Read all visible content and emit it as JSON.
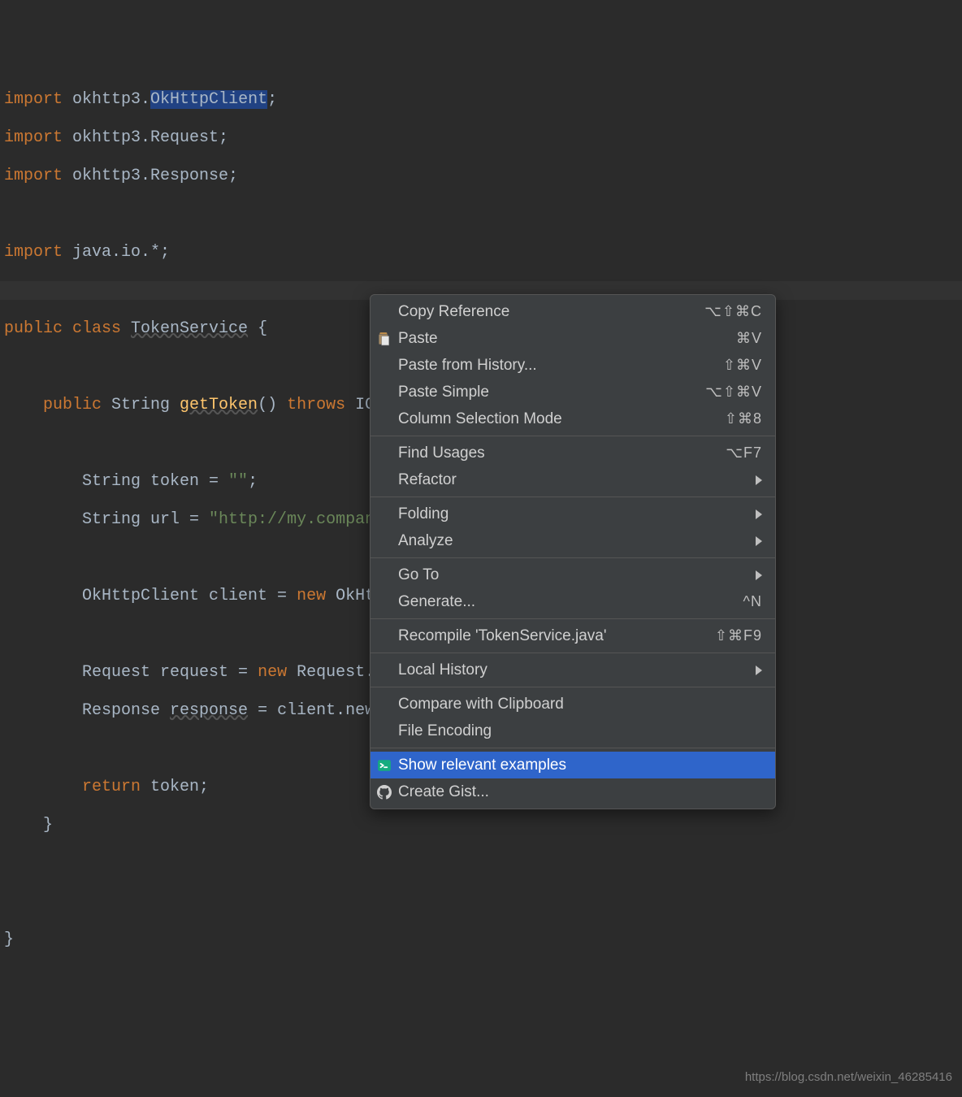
{
  "code": {
    "l1_kw": "import",
    "l1_a": " okhttp3.",
    "l1_sel": "OkHttpClient",
    "l1_b": ";",
    "l2_kw": "import",
    "l2_a": " okhttp3.Request;",
    "l3_kw": "import",
    "l3_a": " okhttp3.Response;",
    "l5_kw": "import",
    "l5_a": " java.io.*;",
    "l7_kw1": "public class ",
    "l7_cls": "TokenService",
    "l7_a": " {",
    "l9_kw1": "    public ",
    "l9_t": "String ",
    "l9_m": "getToken",
    "l9_a": "() ",
    "l9_kw2": "throws ",
    "l9_ex": "IOException {",
    "l11_a": "        String token = ",
    "l11_s": "\"\"",
    "l11_b": ";",
    "l12_a": "        String url = ",
    "l12_s": "\"http://my.company.com/api/token\"",
    "l12_b": ";",
    "l14_a": "        OkHttpClient client = ",
    "l14_kw": "new",
    "l14_b": " OkHttpCl",
    "l16_a": "        Request request = ",
    "l16_kw": "new",
    "l16_b": " Request.Bui",
    "l17_a": "        Response ",
    "l17_u": "response",
    "l17_b": " = client.newCal",
    "l19_kw": "        return ",
    "l19_a": "token;",
    "l20": "    }",
    "l23": "}"
  },
  "menu": {
    "items": [
      {
        "label": "Copy Reference",
        "shortcut": "⌥⇧⌘C",
        "icon": "",
        "sub": false
      },
      {
        "label": "Paste",
        "shortcut": "⌘V",
        "icon": "paste",
        "sub": false
      },
      {
        "label": "Paste from History...",
        "shortcut": "⇧⌘V",
        "icon": "",
        "sub": false
      },
      {
        "label": "Paste Simple",
        "shortcut": "⌥⇧⌘V",
        "icon": "",
        "sub": false
      },
      {
        "label": "Column Selection Mode",
        "shortcut": "⇧⌘8",
        "icon": "",
        "sub": false
      },
      {
        "sep": true
      },
      {
        "label": "Find Usages",
        "shortcut": "⌥F7",
        "icon": "",
        "sub": false
      },
      {
        "label": "Refactor",
        "shortcut": "",
        "icon": "",
        "sub": true
      },
      {
        "sep": true
      },
      {
        "label": "Folding",
        "shortcut": "",
        "icon": "",
        "sub": true
      },
      {
        "label": "Analyze",
        "shortcut": "",
        "icon": "",
        "sub": true
      },
      {
        "sep": true
      },
      {
        "label": "Go To",
        "shortcut": "",
        "icon": "",
        "sub": true
      },
      {
        "label": "Generate...",
        "shortcut": "^N",
        "icon": "",
        "sub": false
      },
      {
        "sep": true
      },
      {
        "label": "Recompile 'TokenService.java'",
        "shortcut": "⇧⌘F9",
        "icon": "",
        "sub": false
      },
      {
        "sep": true
      },
      {
        "label": "Local History",
        "shortcut": "",
        "icon": "",
        "sub": true
      },
      {
        "sep": true
      },
      {
        "label": "Compare with Clipboard",
        "shortcut": "",
        "icon": "",
        "sub": false
      },
      {
        "label": "File Encoding",
        "shortcut": "",
        "icon": "",
        "sub": false
      },
      {
        "sep": true
      },
      {
        "label": "Show relevant examples",
        "shortcut": "",
        "icon": "terminal",
        "sub": false,
        "selected": true
      },
      {
        "label": "Create Gist...",
        "shortcut": "",
        "icon": "github",
        "sub": false
      }
    ]
  },
  "watermark": "https://blog.csdn.net/weixin_46285416"
}
